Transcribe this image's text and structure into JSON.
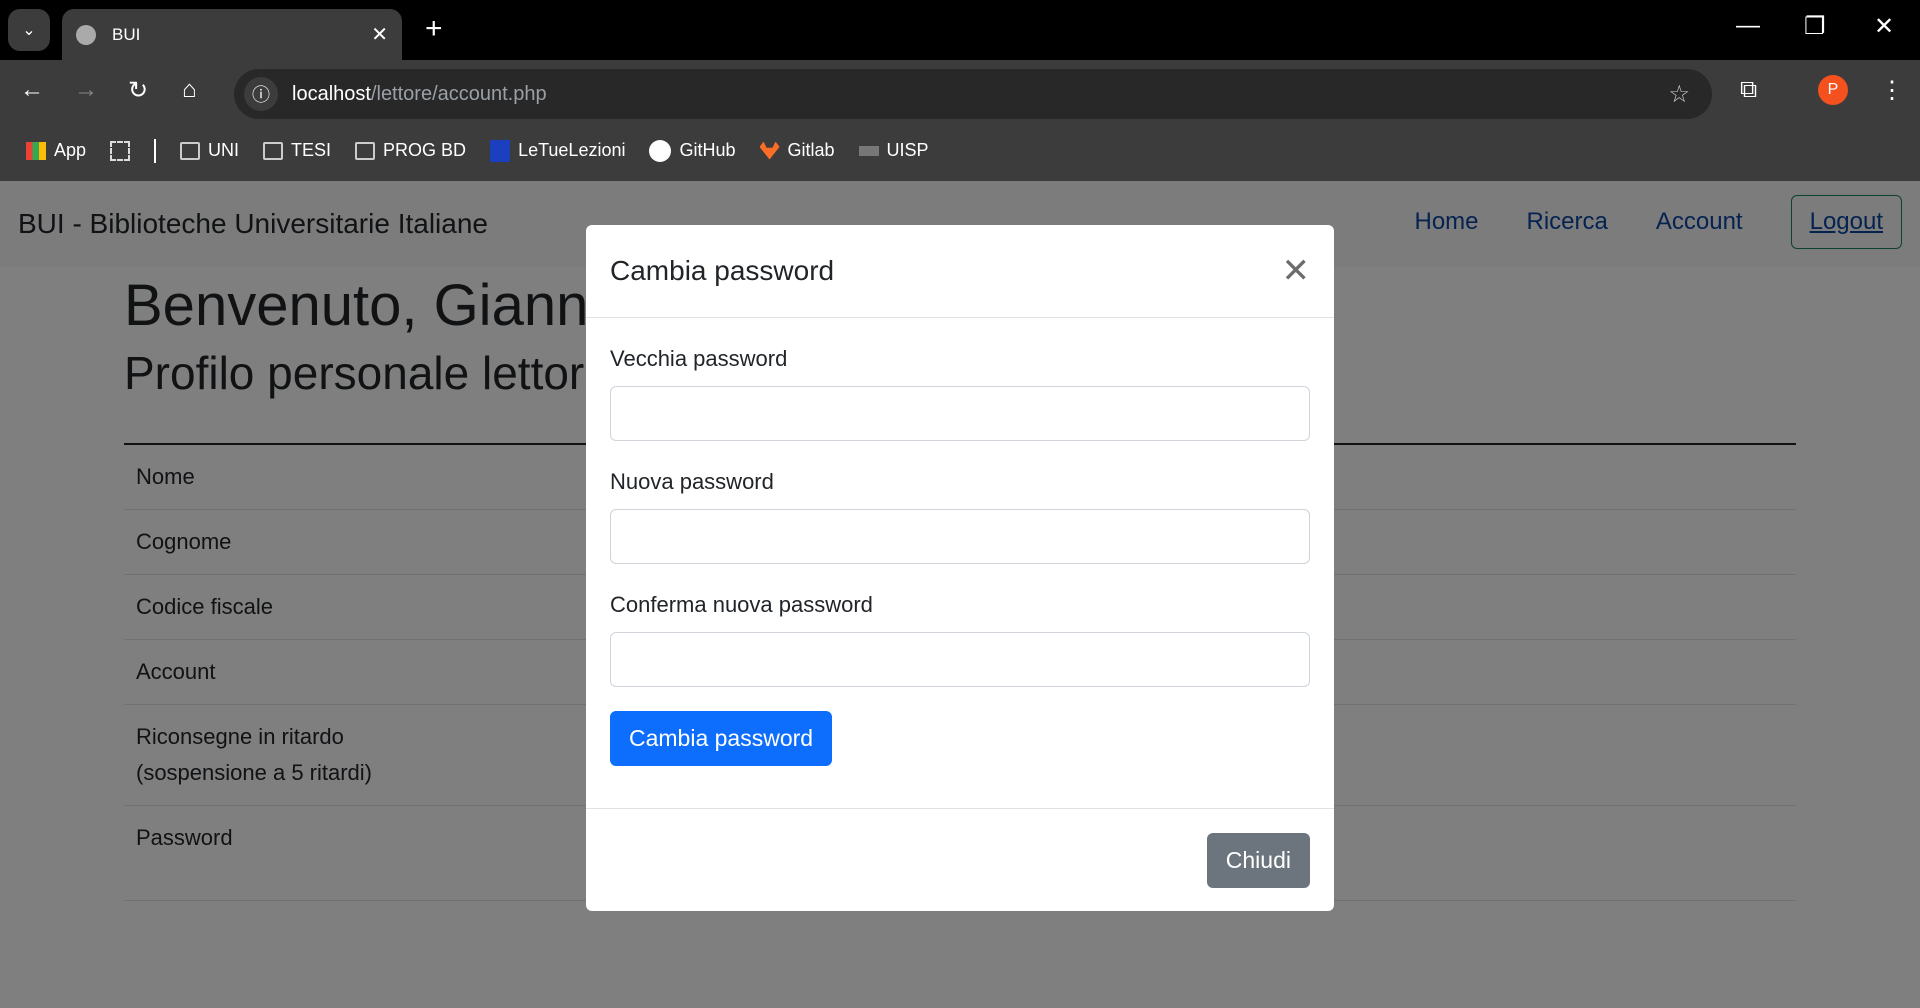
{
  "browser": {
    "tab_title": "BUI",
    "url_host": "localhost",
    "url_path": "/lettore/account.php",
    "avatar_letter": "P",
    "bookmarks": [
      "App",
      "UNI",
      "TESI",
      "PROG BD",
      "LeTueLezioni",
      "GitHub",
      "Gitlab",
      "UISP"
    ]
  },
  "navbar": {
    "brand": "BUI - Biblioteche Universitarie Italiane",
    "links": [
      "Home",
      "Ricerca",
      "Account"
    ],
    "logout": "Logout"
  },
  "main": {
    "heading": "Benvenuto, Gianni",
    "subheading": "Profilo personale lettore",
    "rows": [
      "Nome",
      "Cognome",
      "Codice fiscale",
      "Account",
      "Riconsegne in ritardo",
      "(sospensione a 5 ritardi)",
      "Password"
    ]
  },
  "modal": {
    "title": "Cambia password",
    "fields": [
      "Vecchia password",
      "Nuova password",
      "Conferma nuova password"
    ],
    "submit": "Cambia password",
    "close": "Chiudi"
  }
}
